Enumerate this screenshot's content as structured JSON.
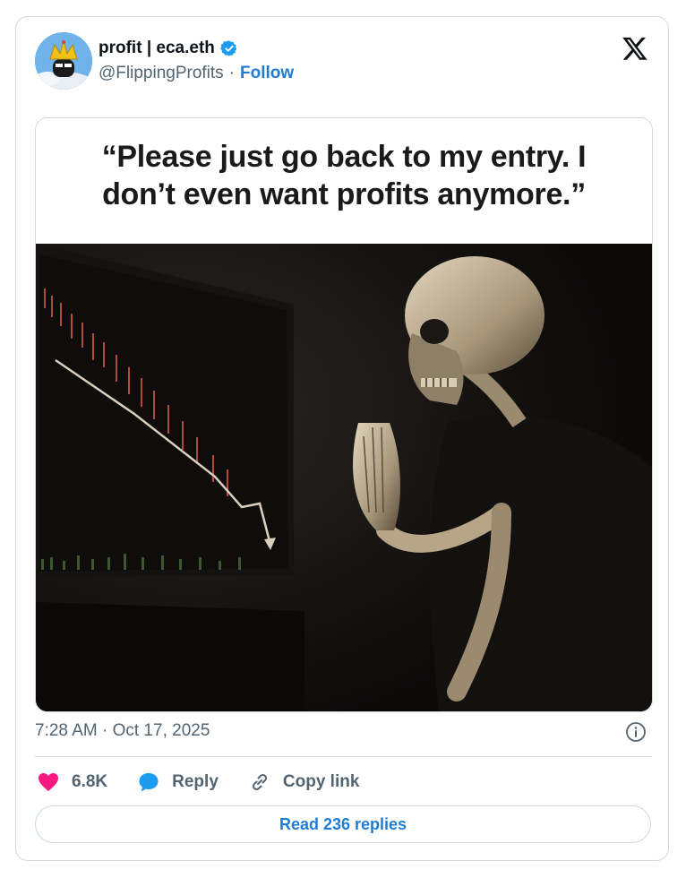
{
  "author": {
    "display_name": "profit | eca.eth",
    "handle": "@FlippingProfits",
    "separator": "·",
    "follow_label": "Follow",
    "verified": true
  },
  "media": {
    "caption_line1": "“Please just go back to my entry. I",
    "caption_line2": "don’t even want profits anymore.”"
  },
  "meta": {
    "timestamp": "7:28 AM · Oct 17, 2025"
  },
  "actions": {
    "like_count": "6.8K",
    "reply_label": "Reply",
    "copy_label": "Copy link"
  },
  "footer": {
    "read_replies_label": "Read 236 replies"
  },
  "colors": {
    "accent": "#1d7dd4",
    "like": "#f91880",
    "verified": "#1d9bf0",
    "muted": "#536471"
  }
}
